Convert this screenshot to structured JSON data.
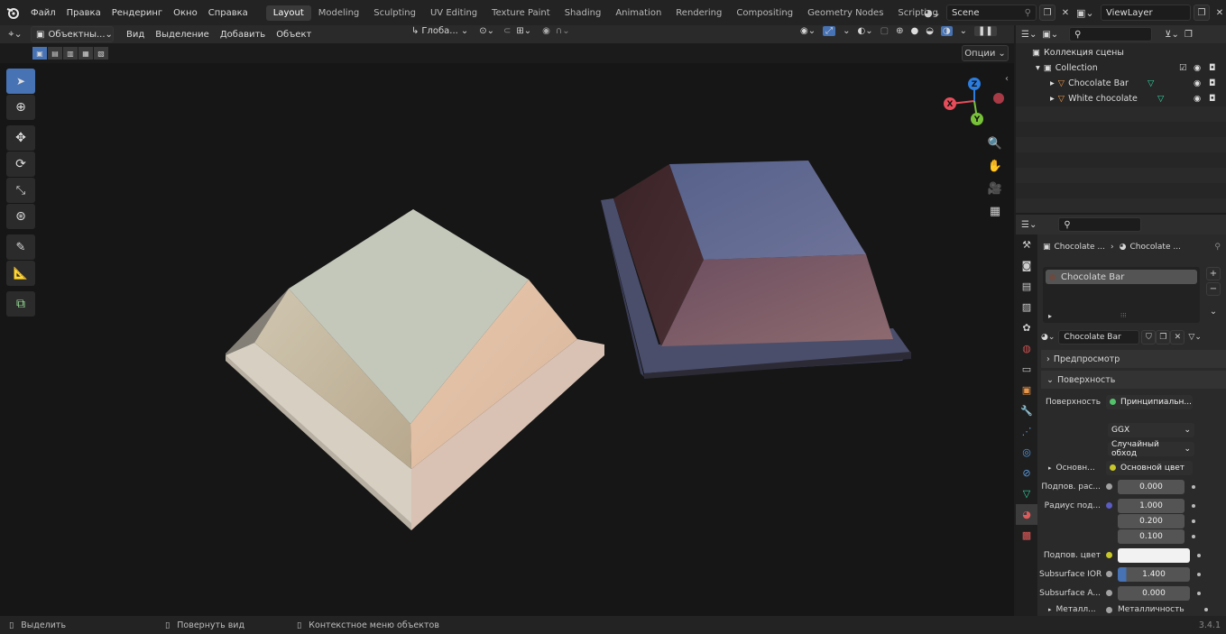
{
  "menu": [
    "Файл",
    "Правка",
    "Рендеринг",
    "Окно",
    "Справка"
  ],
  "workspaces": [
    "Layout",
    "Modeling",
    "Sculpting",
    "UV Editing",
    "Texture Paint",
    "Shading",
    "Animation",
    "Rendering",
    "Compositing",
    "Geometry Nodes",
    "Scripting"
  ],
  "active_workspace": "Layout",
  "scene": {
    "name": "Scene"
  },
  "view_layer": {
    "name": "ViewLayer"
  },
  "viewport_header": {
    "mode": "Объектны...",
    "menus": [
      "Вид",
      "Выделение",
      "Добавить",
      "Объект"
    ],
    "transform_orientation": "Глоба...",
    "options_label": "Опции"
  },
  "gizmo": {
    "x": "X",
    "y": "Y",
    "z": "Z"
  },
  "outliner": {
    "scene_collection": "Коллекция сцены",
    "collection": "Collection",
    "objects": [
      "Chocolate Bar",
      "White chocolate"
    ]
  },
  "properties": {
    "breadcrumb_object": "Chocolate ...",
    "breadcrumb_material": "Chocolate ...",
    "material_slot": "Chocolate Bar",
    "material_name": "Chocolate Bar",
    "panels": {
      "preview": "Предпросмотр",
      "surface": "Поверхность"
    },
    "surface_label": "Поверхность",
    "surface_shader": "Принципиальн...",
    "distribution": "GGX",
    "subsurface_method": "Случайный обход",
    "base_color_label": "Основн...",
    "base_color_value": "Основной цвет",
    "subsurface_label": "Подпов. рас...",
    "subsurface_value": "0.000",
    "radius_label": "Радиус под...",
    "radius_values": [
      "1.000",
      "0.200",
      "0.100"
    ],
    "subsurface_color_label": "Подпов. цвет",
    "subsurface_ior_label": "Subsurface IOR",
    "subsurface_ior_value": "1.400",
    "subsurface_aniso_label": "Subsurface A...",
    "subsurface_aniso_value": "0.000",
    "metallic_label": "Металл...",
    "metallic_value": "Металличность"
  },
  "statusbar": {
    "select": "Выделить",
    "rotate": "Повернуть вид",
    "context": "Контекстное меню объектов",
    "version": "3.4.1"
  },
  "colors": {
    "accent": "#4772b3",
    "white_chocolate_top": "#c5c9ba",
    "chocolate_top": "#5b6690"
  }
}
